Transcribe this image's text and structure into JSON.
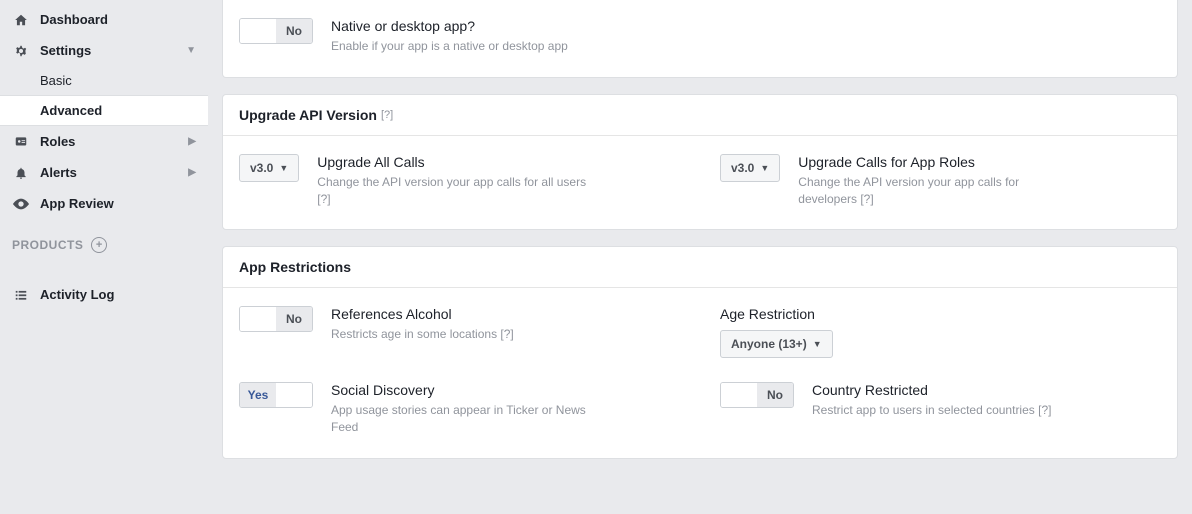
{
  "sidebar": {
    "dashboard": "Dashboard",
    "settings": "Settings",
    "settings_basic": "Basic",
    "settings_advanced": "Advanced",
    "roles": "Roles",
    "alerts": "Alerts",
    "app_review": "App Review",
    "products_label": "PRODUCTS",
    "activity_log": "Activity Log"
  },
  "native": {
    "title": "Native or desktop app?",
    "desc": "Enable if your app is a native or desktop app",
    "toggle_no": "No"
  },
  "upgrade": {
    "header": "Upgrade API Version",
    "help": "[?]",
    "all": {
      "version": "v3.0",
      "title": "Upgrade All Calls",
      "desc": "Change the API version your app calls for all users  [?]"
    },
    "roles": {
      "version": "v3.0",
      "title": "Upgrade Calls for App Roles",
      "desc": "Change the API version your app calls for developers  [?]"
    }
  },
  "restrictions": {
    "header": "App Restrictions",
    "alcohol": {
      "title": "References Alcohol",
      "desc": "Restricts age in some locations  [?]",
      "toggle_no": "No"
    },
    "age": {
      "title": "Age Restriction",
      "value": "Anyone (13+)"
    },
    "social": {
      "title": "Social Discovery",
      "desc": "App usage stories can appear in Ticker or News Feed",
      "toggle_yes": "Yes"
    },
    "country": {
      "title": "Country Restricted",
      "desc": "Restrict app to users in selected countries  [?]",
      "toggle_no": "No"
    }
  }
}
